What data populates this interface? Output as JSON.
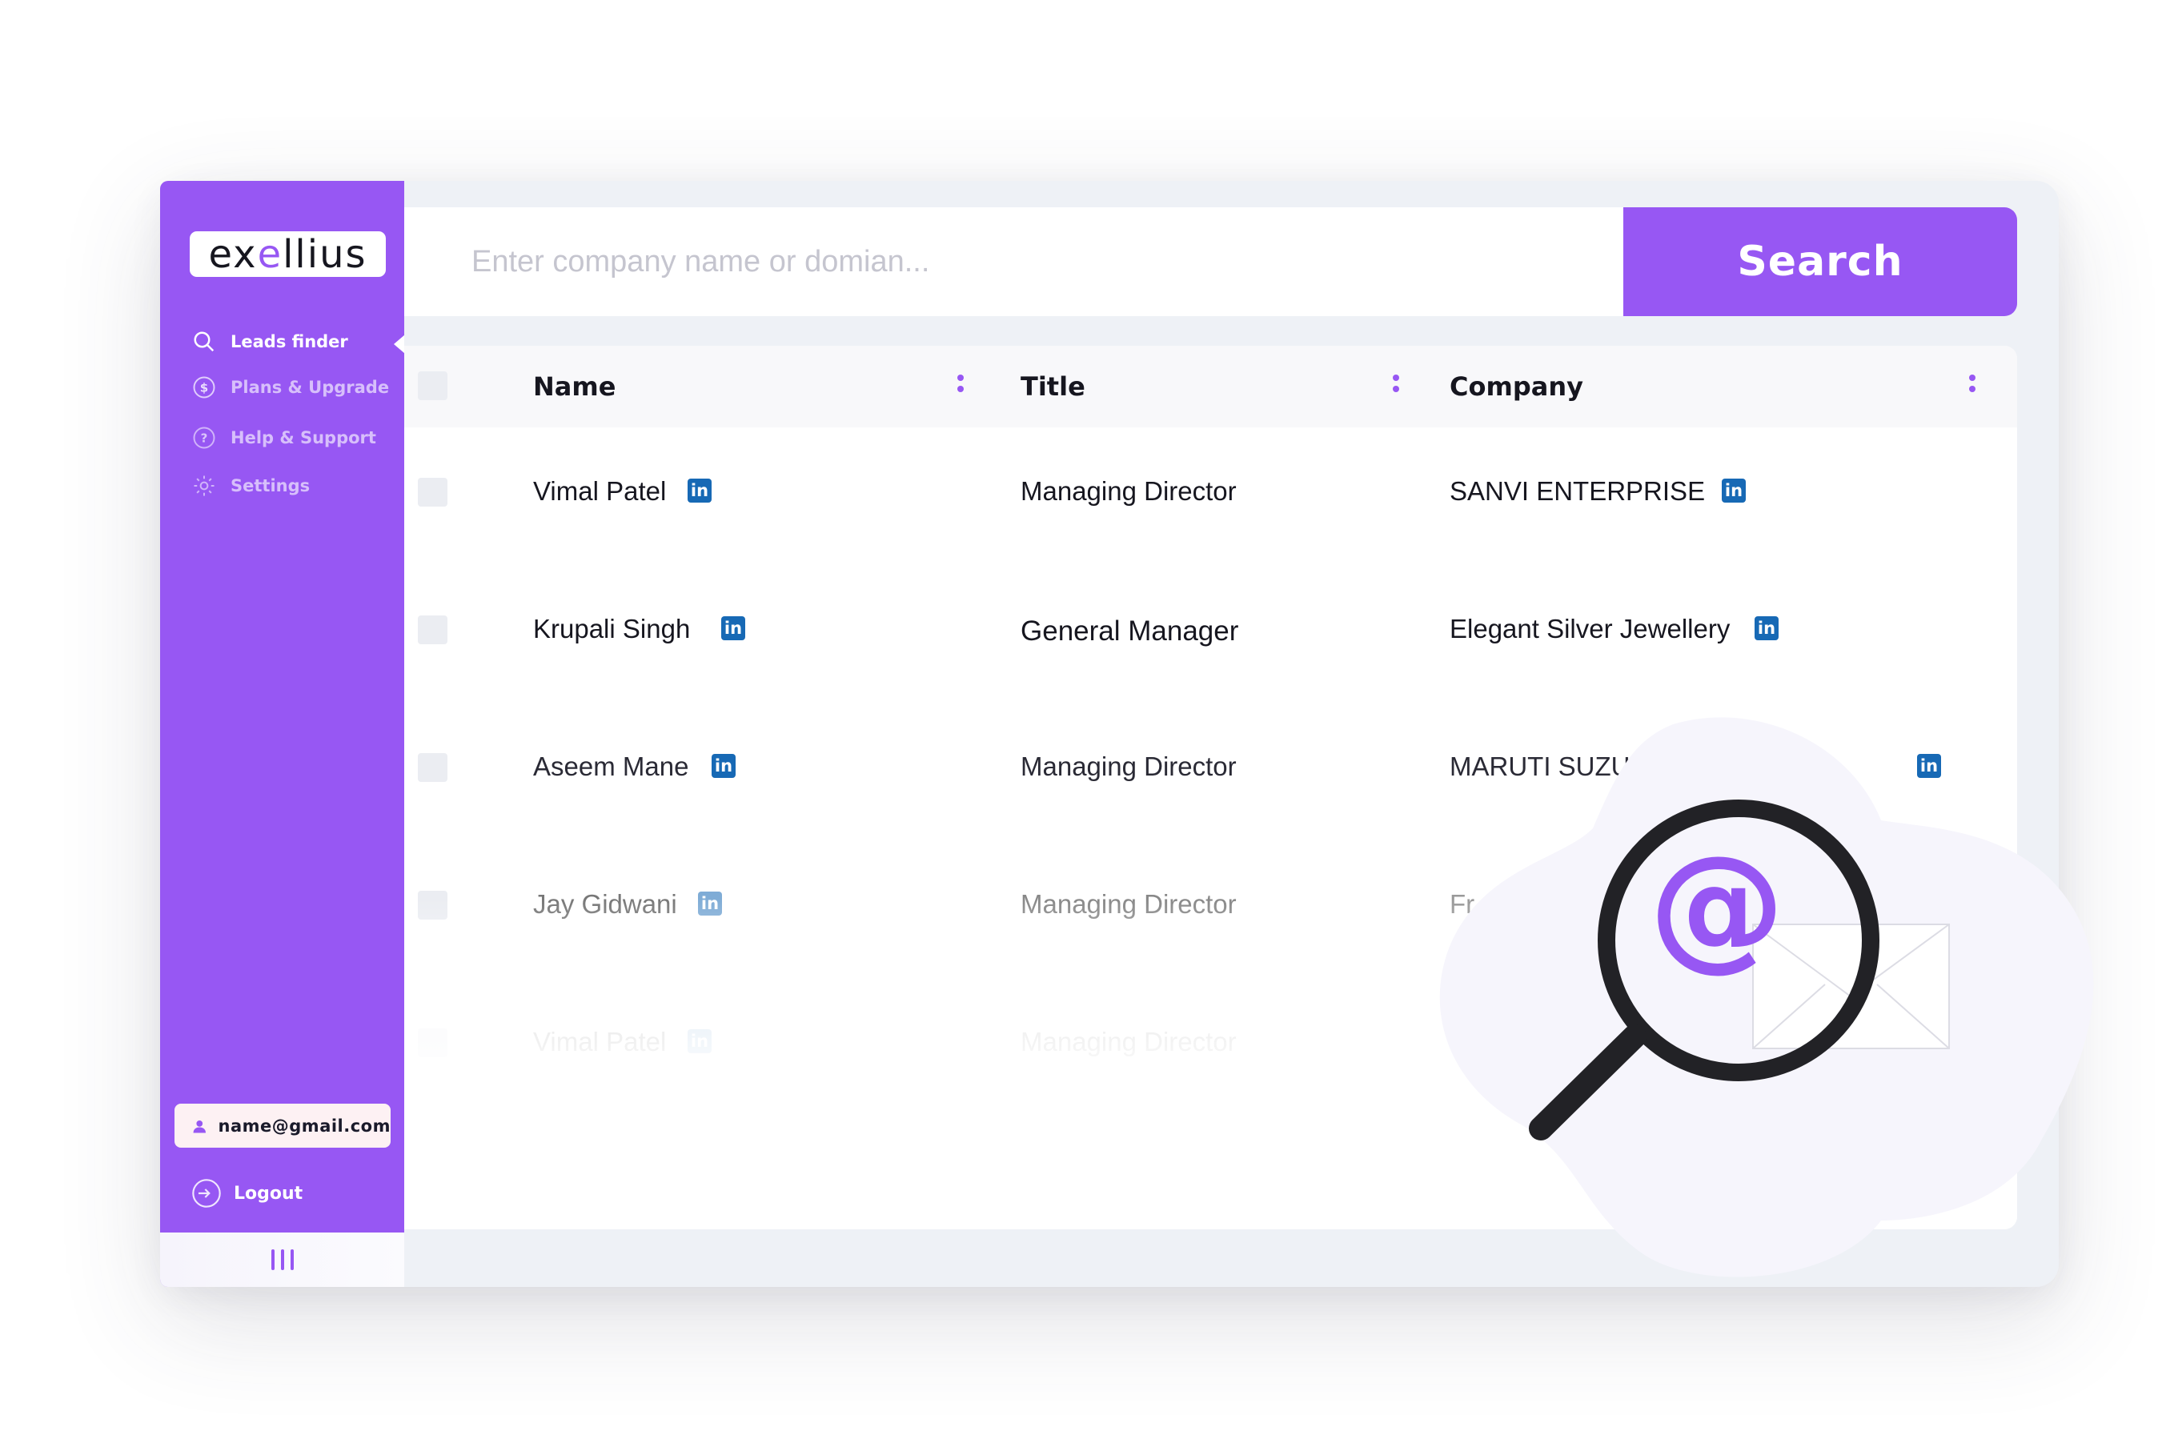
{
  "brand": {
    "logo_prefix": "ex",
    "logo_accent": "e",
    "logo_suffix": "llius",
    "accent_color": "#9757f3"
  },
  "sidebar": {
    "items": [
      {
        "label": "Leads finder",
        "icon": "search-icon",
        "active": true
      },
      {
        "label": "Plans & Upgrade",
        "icon": "dollar-icon",
        "active": false
      },
      {
        "label": "Help & Support",
        "icon": "help-icon",
        "active": false
      },
      {
        "label": "Settings",
        "icon": "gear-icon",
        "active": false
      }
    ],
    "user_email": "name@gmail.com",
    "logout_label": "Logout"
  },
  "search": {
    "placeholder": "Enter company name or domian...",
    "button_label": "Search"
  },
  "table": {
    "columns": [
      "Name",
      "Title",
      "Company"
    ],
    "rows": [
      {
        "name": "Vimal Patel",
        "title": "Managing Director",
        "company": "SANVI ENTERPRISE"
      },
      {
        "name": "Krupali Singh",
        "title": "General Manager",
        "company": "Elegant Silver Jewellery"
      },
      {
        "name": "Aseem Mane",
        "title": "Managing Director",
        "company": "MARUTI SUZUKI NEXA"
      },
      {
        "name": "Jay Gidwani",
        "title": "Managing Director",
        "company": "Fr"
      },
      {
        "name": "Vimal Patel",
        "title": "Managing Director",
        "company": ""
      }
    ],
    "linkedin_label": "in"
  },
  "illustration": {
    "at_symbol": "@"
  }
}
